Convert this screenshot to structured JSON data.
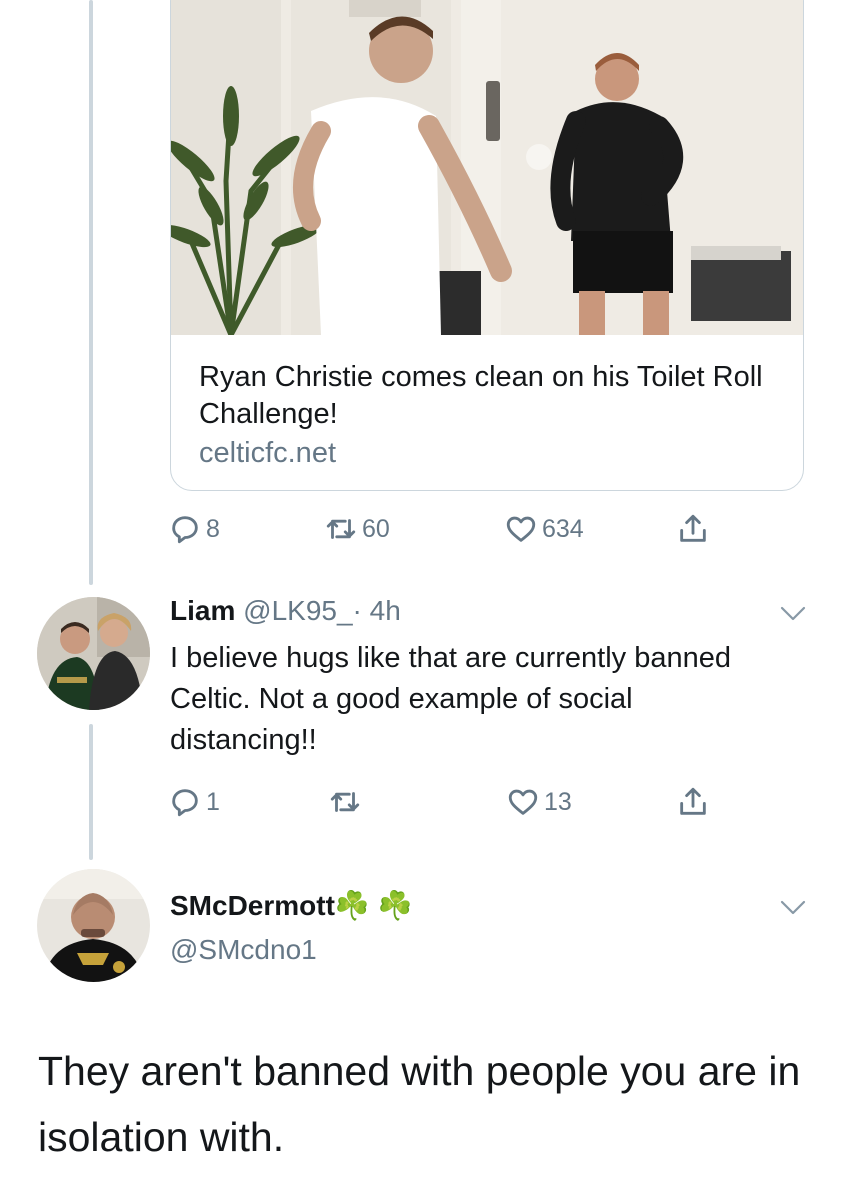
{
  "link_card": {
    "title": "Ryan Christie comes clean on his Toilet Roll Challenge!",
    "domain": "celticfc.net"
  },
  "tweet1_actions": {
    "replies": "8",
    "retweets": "60",
    "likes": "634"
  },
  "reply": {
    "name": "Liam",
    "handle": "@LK95_",
    "separator": "·",
    "time": "4h",
    "text": "I believe hugs like that are currently banned Celtic. Not a good example of social distancing!!",
    "replies": "1",
    "retweets": "",
    "likes": "13"
  },
  "main_tweet": {
    "name": "SMcDermott",
    "emoji": "☘️ ☘️",
    "handle": "@SMcdno1",
    "text": "They aren't banned with people you are in isolation with."
  },
  "colors": {
    "secondary_text": "#657786",
    "thread_line": "#ccd6dd",
    "border": "#ccd6dd"
  },
  "icons": [
    "reply-icon",
    "retweet-icon",
    "like-icon",
    "share-icon",
    "chevron-down-icon",
    "shamrock-icon"
  ]
}
